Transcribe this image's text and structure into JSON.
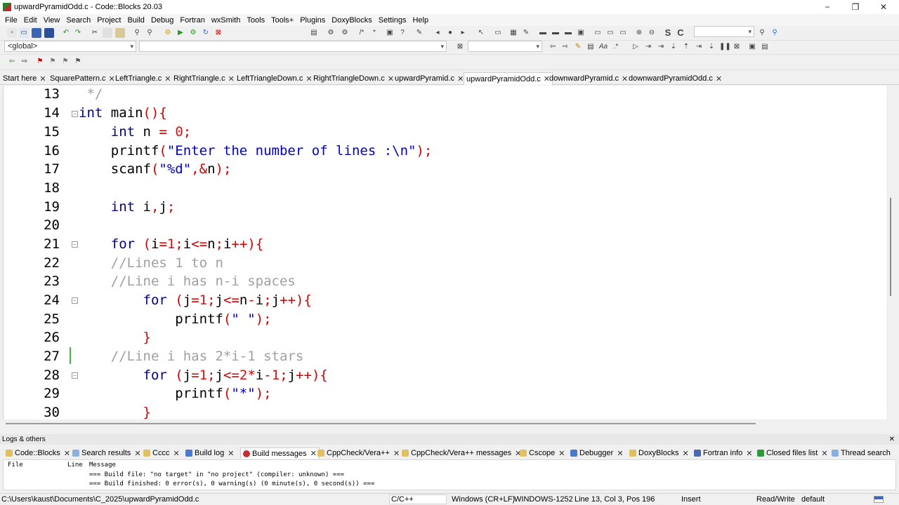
{
  "window": {
    "title": "upwardPyramidOdd.c - Code::Blocks 20.03",
    "minimize": "−",
    "maximize": "❐",
    "close": "✕"
  },
  "menu": [
    "File",
    "Edit",
    "View",
    "Search",
    "Project",
    "Build",
    "Debug",
    "Fortran",
    "wxSmith",
    "Tools",
    "Tools+",
    "Plugins",
    "DoxyBlocks",
    "Settings",
    "Help"
  ],
  "toolbar2": {
    "scope": "<global>",
    "symbol": ""
  },
  "tabs": [
    {
      "label": "Start here"
    },
    {
      "label": "SquarePattern.c"
    },
    {
      "label": "LeftTriangle.c"
    },
    {
      "label": "RightTriangle.c"
    },
    {
      "label": "LeftTriangleDown.c"
    },
    {
      "label": "RightTriangleDown.c"
    },
    {
      "label": "upwardPyramid.c"
    },
    {
      "label": "upwardPyramidOdd.c"
    },
    {
      "label": "downwardPyramid.c"
    },
    {
      "label": "downwardPyramidOdd.c"
    }
  ],
  "active_tab": "upwardPyramidOdd.c",
  "code": {
    "line_numbers": [
      "13",
      "14",
      "15",
      "16",
      "17",
      "18",
      "19",
      "20",
      "21",
      "22",
      "23",
      "24",
      "25",
      "26",
      "27",
      "28",
      "29",
      "30"
    ]
  },
  "logs": {
    "header": "Logs & others",
    "tabs": [
      "Code::Blocks",
      "Search results",
      "Cccc",
      "Build log",
      "Build messages",
      "CppCheck/Vera++",
      "CppCheck/Vera++ messages",
      "Cscope",
      "Debugger",
      "DoxyBlocks",
      "Fortran info",
      "Closed files list",
      "Thread search"
    ],
    "active": "Build messages",
    "columns": {
      "file": "File",
      "line": "Line",
      "message": "Message"
    },
    "messages": [
      "=== Build file: \"no target\" in \"no project\" (compiler: unknown) ===",
      "=== Build finished: 0 error(s), 0 warning(s) (0 minute(s), 0 second(s)) ==="
    ]
  },
  "status": {
    "path": "C:\\Users\\kaust\\Documents\\C_2025\\upwardPyramidOdd.c",
    "lang": "C/C++",
    "eol": "Windows (CR+LF)",
    "encoding": "WINDOWS-1252",
    "position": "Line 13, Col 3, Pos 196",
    "mode": "Insert",
    "access": "Read/Write",
    "profile": "default"
  }
}
